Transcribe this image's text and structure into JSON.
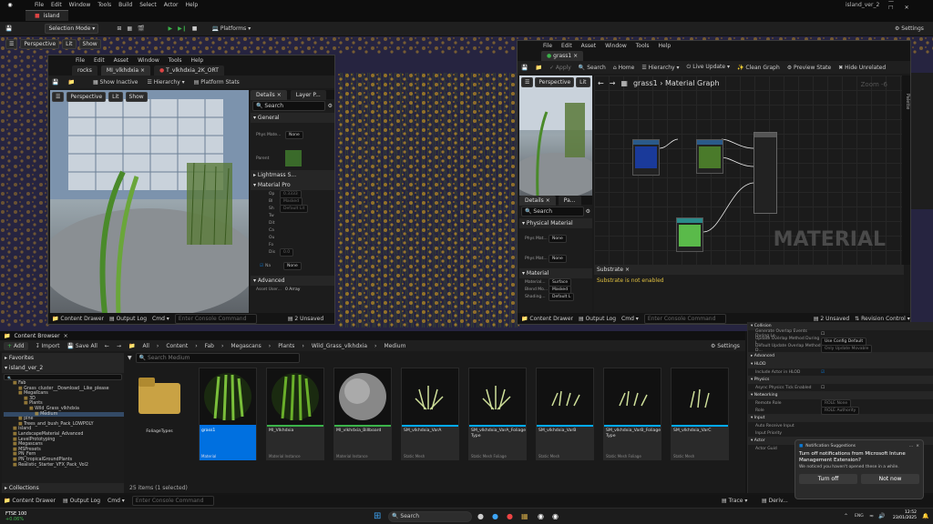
{
  "menu": {
    "items": [
      "File",
      "Edit",
      "Window",
      "Tools",
      "Build",
      "Select",
      "Actor",
      "Help"
    ],
    "project": "island_ver_2"
  },
  "level_tab": "island",
  "toolbar": {
    "selection_mode": "Selection Mode",
    "platforms": "Platforms",
    "settings": "Settings"
  },
  "viewport": {
    "perspective": "Perspective",
    "lit": "Lit",
    "show": "Show",
    "material_text": "MATERIAL"
  },
  "mi_editor": {
    "menu": [
      "File",
      "Edit",
      "Asset",
      "Window",
      "Tools",
      "Help"
    ],
    "tabs": [
      "rocks",
      "MI_vlkhdxia",
      "T_vlkhdxia_2K_ORT"
    ],
    "toolbar": [
      "Show Inactive",
      "Hierarchy",
      "Platform Stats"
    ],
    "vp_buttons": [
      "Perspective",
      "Lit",
      "Show"
    ],
    "details_tab": "Details",
    "layer_tab": "Layer P...",
    "search": "Search",
    "general": "General",
    "phys_mat": "Phys Mate...",
    "phys_val": "None",
    "parent": "Parent",
    "lightmass": "Lightmass S...",
    "material_prop": "Material Pro",
    "op": "Op",
    "op_val": "0.3333",
    "bl": "Bl",
    "bl_val": "Masked",
    "sh": "Sh",
    "sh_val": "Default Lit",
    "tw": "Tw",
    "dit": "Dit",
    "cas": "Ca",
    "out": "Ou",
    "fo": "Fo",
    "dis": "Dis",
    "dis_val": "0.0",
    "na": "Na",
    "na_val": "None",
    "advanced": "Advanced",
    "asset_user": "Asset User...",
    "asset_user_val": "0 Array",
    "content_drawer": "Content Drawer",
    "output_log": "Output Log",
    "cmd": "Cmd",
    "console": "Enter Console Command",
    "unsaved": "2 Unsaved"
  },
  "mat_editor": {
    "menu": [
      "File",
      "Edit",
      "Asset",
      "Window",
      "Tools",
      "Help"
    ],
    "tab": "grass1",
    "toolbar": [
      "Apply",
      "Search",
      "Home",
      "Hierarchy",
      "Live Update",
      "Clean Graph",
      "Preview State",
      "Hide Unrelated"
    ],
    "breadcrumb": "grass1 › Material Graph",
    "zoom": "Zoom -6",
    "vp_buttons": [
      "Perspective",
      "Lit"
    ],
    "details_tab": "Details",
    "pal_tab": "Pa...",
    "search": "Search",
    "physical_material": "Physical Material",
    "phys_mat1": "Phys Mat...",
    "phys_mat2": "Phys Mat...",
    "none": "None",
    "material": "Material",
    "material_domain": "Material...",
    "material_domain_val": "Surface",
    "blend_mode": "Blend Mo...",
    "blend_mode_val": "Masked",
    "shading": "Shading...",
    "shading_val": "Default L",
    "substrate_title": "Substrate",
    "substrate_msg": "Substrate is not enabled",
    "graph_label": "MATERIAL",
    "palette": "Palette",
    "content_drawer": "Content Drawer",
    "output_log": "Output Log",
    "cmd": "Cmd",
    "console": "Enter Console Command",
    "unsaved": "2 Unsaved",
    "revision": "Revision Control"
  },
  "right_props": {
    "collision": "Collision",
    "gen_overlap": "Generate Overlap Events During Le...",
    "update_overlap": "Update Overlap Method During L...",
    "update_overlap_val": "Use Config Default",
    "default_overlap": "Default Update Overlap Method D...",
    "default_overlap_val": "Only Update Movable",
    "advanced": "Advanced",
    "hlod": "HLOD",
    "include_hlod": "Include Actor in HLOD",
    "physics": "Physics",
    "async": "Async Physics Tick Enabled",
    "networking": "Networking",
    "remote_role": "Remote Role",
    "remote_role_val": "ROLE None",
    "role": "Role",
    "role_val": "ROLE Authority",
    "input": "Input",
    "auto_receive": "Auto Receive Input",
    "input_priority": "Input Priority",
    "actor": "Actor",
    "actor_guid": "Actor Guid"
  },
  "content_browser": {
    "title": "Content Browser",
    "add": "Add",
    "import": "Import",
    "save_all": "Save All",
    "path": [
      "All",
      "Content",
      "Fab",
      "Megascans",
      "Plants",
      "Wild_Grass_vlkhdxia",
      "Medium"
    ],
    "settings": "Settings",
    "favorites": "Favorites",
    "root": "island_ver_2",
    "search": "Search Medium",
    "collections": "Collections",
    "status": "25 items (1 selected)",
    "tree": [
      "Fab",
      "Grass_cluster__Download__Like_please",
      "Megascans",
      "3D",
      "Plants",
      "Wild_Grass_vlkhdxia",
      "Medium",
      "pine",
      "Trees_and_bush_Pack_LOWPOLY",
      "island",
      "LandscapeMaterial_Advanced",
      "LevelPrototyping",
      "Megascans",
      "MSPresets",
      "PN_Fern",
      "PN_tropicalGroundPlants",
      "Realistic_Starter_VFX_Pack_Vol2"
    ],
    "assets": [
      {
        "name": "FoliageTypes",
        "type": ""
      },
      {
        "name": "grass1",
        "type": "Material"
      },
      {
        "name": "MI_Vlkhdxia",
        "type": "Material Instance"
      },
      {
        "name": "MI_vlkhdxia_Billboard",
        "type": "Material Instance"
      },
      {
        "name": "SM_vlkhdxia_VarA",
        "type": "Static Mesh"
      },
      {
        "name": "SM_vlkhdxia_VarA_Foliage Type",
        "type": "Static Mesh Foliage"
      },
      {
        "name": "SM_vlkhdxia_VarB",
        "type": "Static Mesh"
      },
      {
        "name": "SM_vlkhdxia_VarB_Foliage Type",
        "type": "Static Mesh Foliage"
      },
      {
        "name": "SM_vlkhdxia_VarC",
        "type": "Static Mesh"
      }
    ]
  },
  "bottom_bar": {
    "content_drawer": "Content Drawer",
    "output_log": "Output Log",
    "cmd": "Cmd",
    "console": "Enter Console Command",
    "trace": "Trace",
    "derived": "Deriv..."
  },
  "notification": {
    "title": "Notification Suggestions",
    "body1": "Turn off notifications from Microsoft Intune Management Extension?",
    "body2": "We noticed you haven't opened these in a while.",
    "turn_off": "Turn off",
    "not_now": "Not now"
  },
  "taskbar": {
    "stock_name": "FTSE 100",
    "stock_change": "+0.06%",
    "search": "Search",
    "time": "12:52",
    "date": "23/01/2025",
    "lang": "ENG"
  },
  "colors": {
    "accent": "#0a7ad8",
    "selected": "#0070e0",
    "foliage": "#f0b020",
    "green": "#3bb34a"
  }
}
